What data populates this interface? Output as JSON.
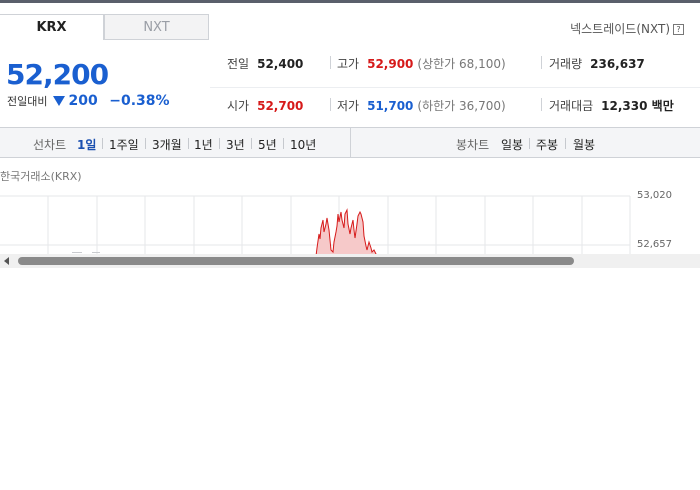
{
  "tabs": [
    {
      "label": "KRX",
      "active": true
    },
    {
      "label": "NXT",
      "active": false
    }
  ],
  "nxt_link": {
    "label": "넥스트레이드(NXT)",
    "help_icon": "?"
  },
  "price": {
    "current": "52,200",
    "change_label": "전일대비",
    "change_amount": "200",
    "change_direction": "down",
    "change_percent": "−0.38%"
  },
  "stats": {
    "prev_close": {
      "label": "전일",
      "value": "52,400"
    },
    "high": {
      "label": "고가",
      "value": "52,900",
      "sub": "(상한가 68,100)"
    },
    "volume": {
      "label": "거래량",
      "value": "236,637"
    },
    "open": {
      "label": "시가",
      "value": "52,700"
    },
    "low": {
      "label": "저가",
      "value": "51,700",
      "sub": "(하한가 36,700)"
    },
    "trade_value": {
      "label": "거래대금",
      "value": "12,330 백만"
    }
  },
  "line_chart": {
    "label": "선차트",
    "periods": [
      "1일",
      "1주일",
      "3개월",
      "1년",
      "3년",
      "5년",
      "10년"
    ],
    "active": "1일"
  },
  "candle_chart": {
    "label": "봉차트",
    "periods": [
      "일봉",
      "주봉",
      "월봉"
    ]
  },
  "chart": {
    "title": "한국거래소(KRX)",
    "y_ticks": [
      "53,020",
      "52,657"
    ],
    "line_color": "#d61a1a",
    "fill_color": "#f6c9c9"
  },
  "colors": {
    "up": "#d61a1a",
    "down": "#1a5fd0",
    "accent": "#1a4fb0"
  }
}
